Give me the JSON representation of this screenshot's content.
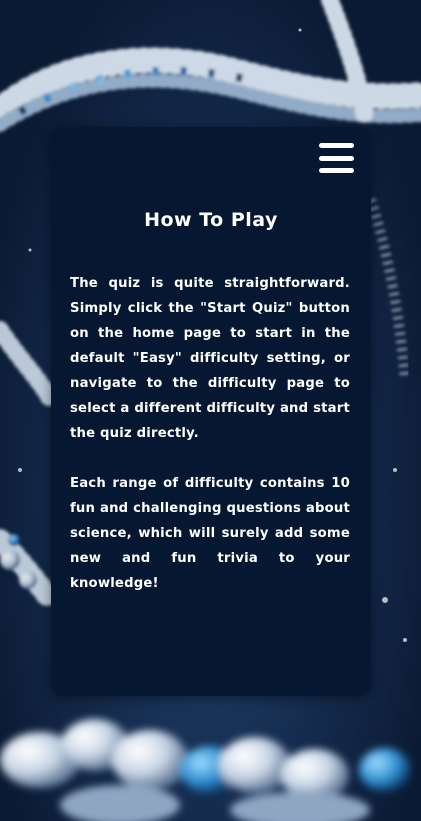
{
  "page": {
    "title": "How To Play",
    "paragraphs": [
      "The quiz is quite straightforward. Simply click the \"Start Quiz\" button on the home page to start in the default \"Easy\" difficulty setting, or navigate to the difficulty page to select a different difficulty and start the quiz directly.",
      "Each range of difficulty contains 10 fun and challenging questions about science, which will surely add some new and fun trivia to your knowledge!"
    ]
  },
  "icons": {
    "menu": "hamburger-menu-icon"
  },
  "colors": {
    "card_background": "#061731",
    "page_background": "#152c4f",
    "text": "#ffffff",
    "dna_accent": "#2f8fd0"
  }
}
